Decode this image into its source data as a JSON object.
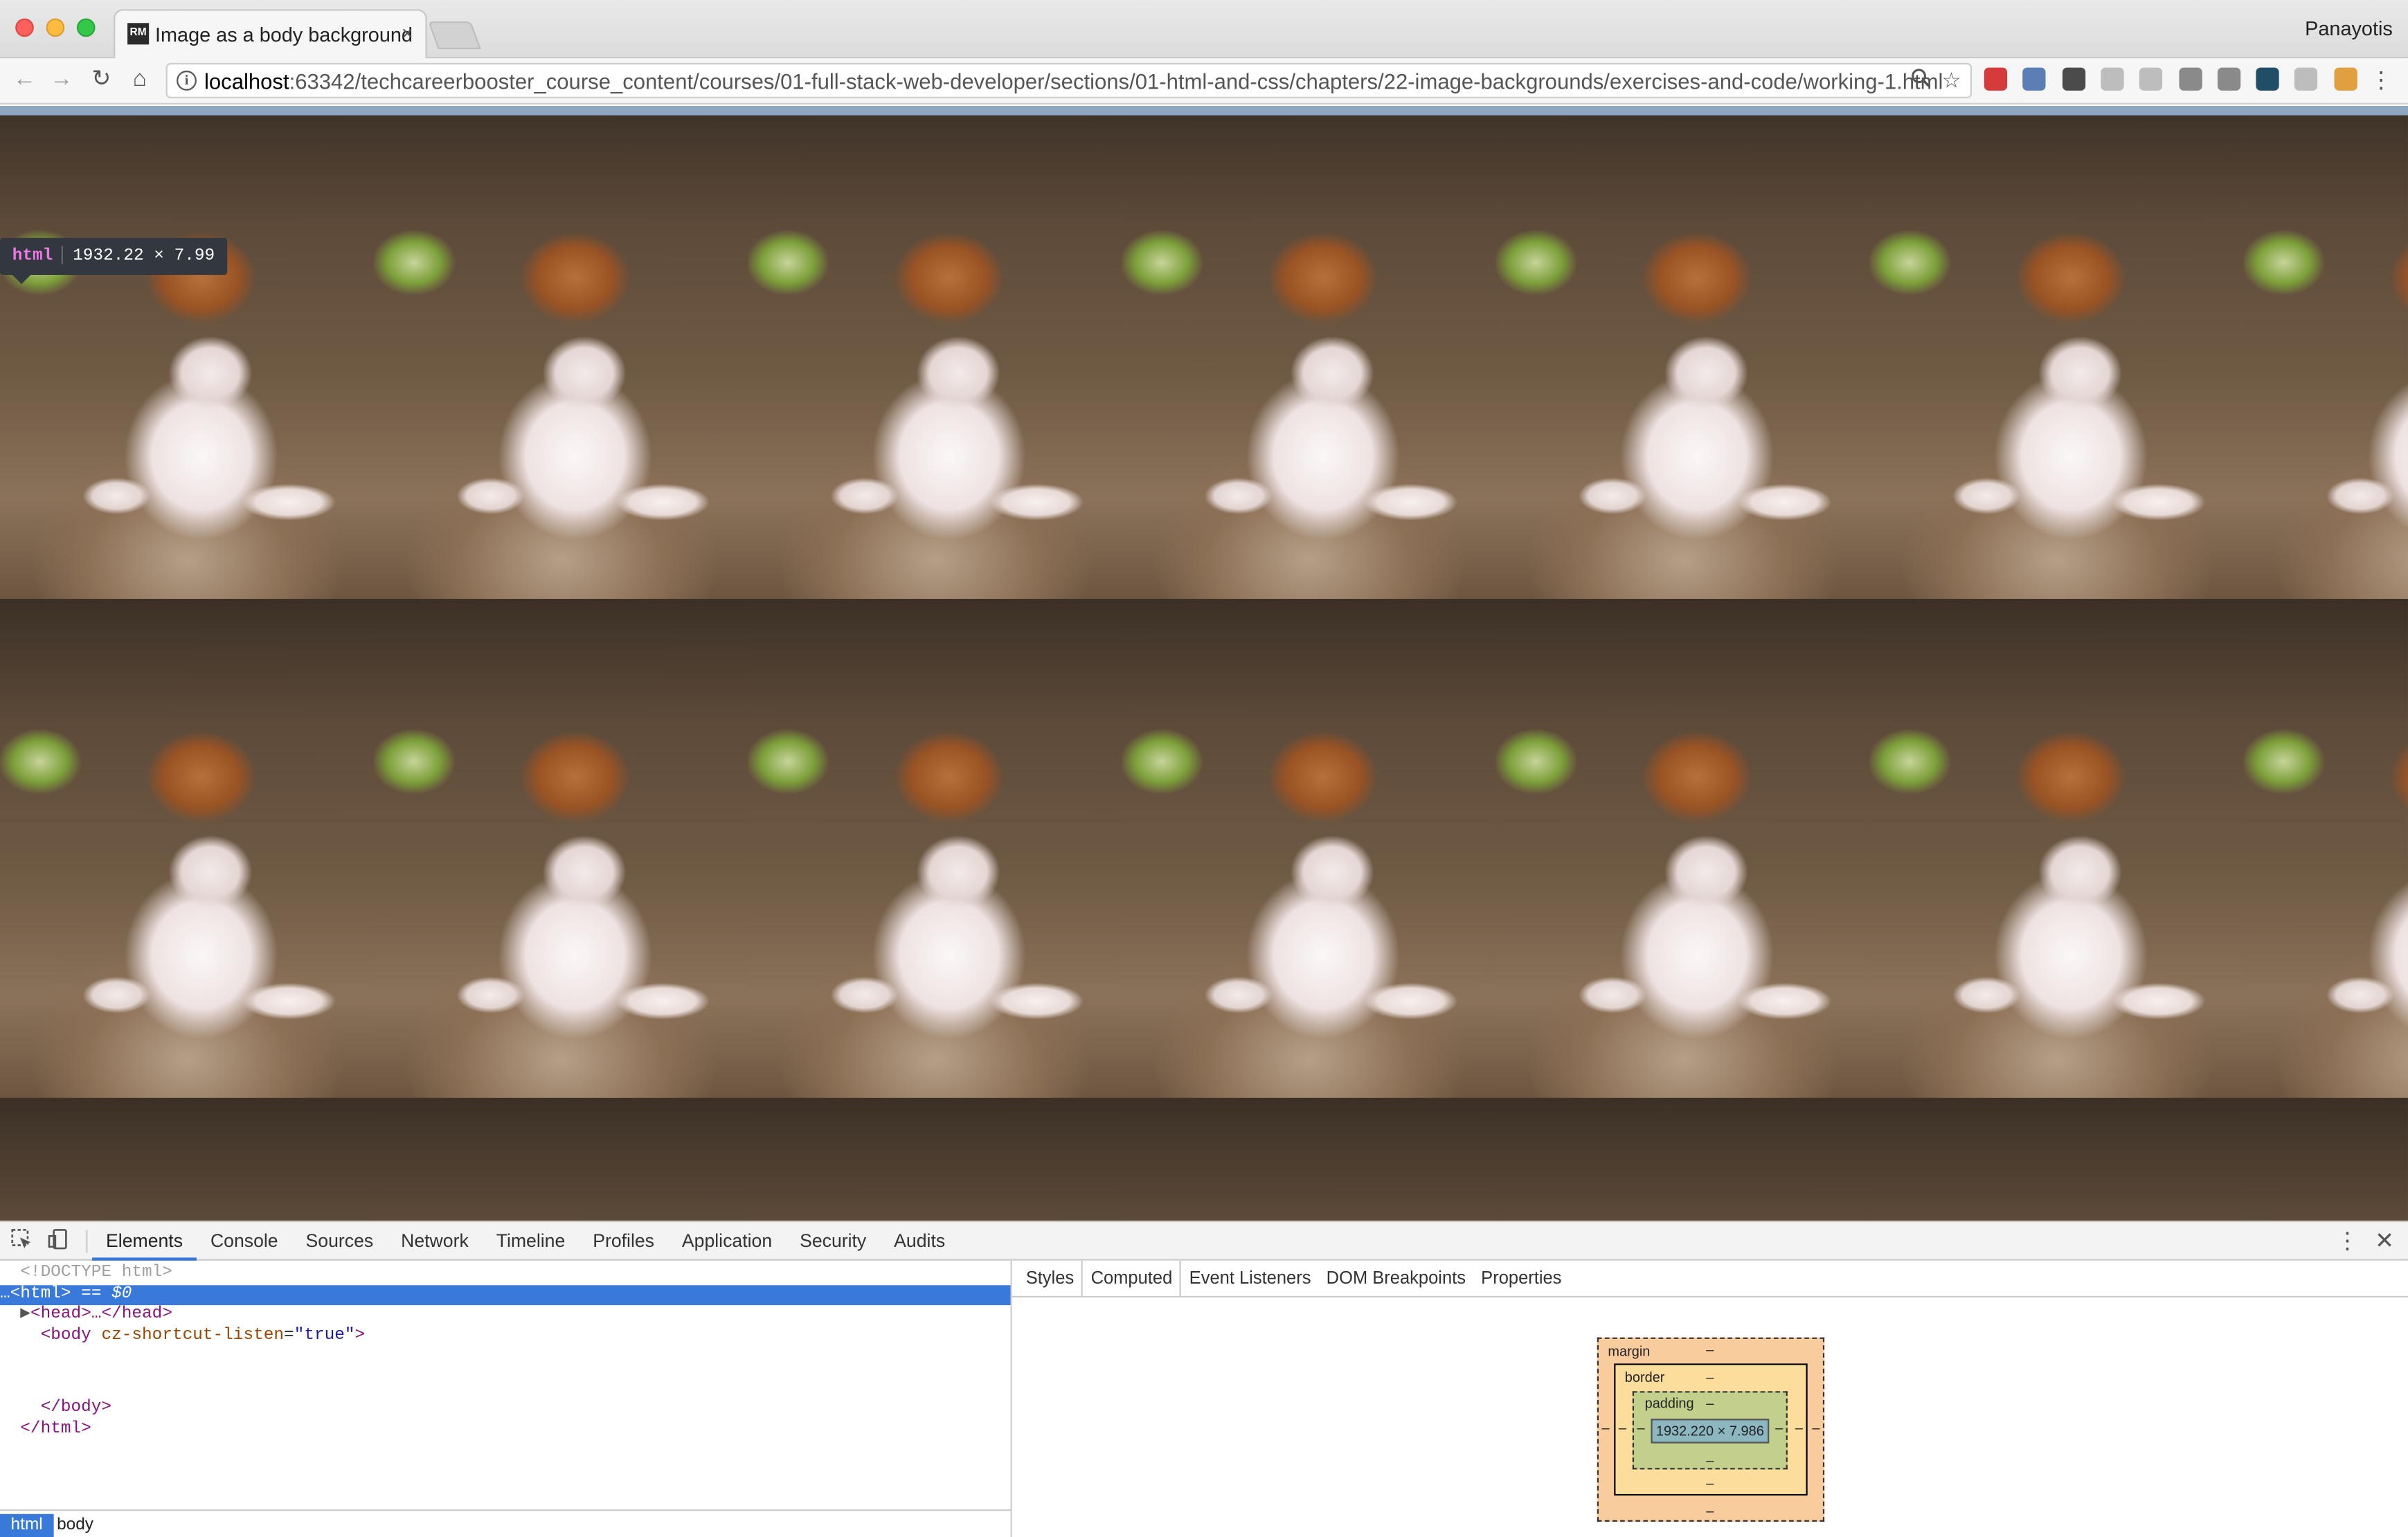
{
  "browser": {
    "tab_title": "Image as a body background",
    "tab_favicon": "RM",
    "user_name": "Panayotis",
    "url_host": "localhost",
    "url_rest": ":63342/techcareerbooster_course_content/courses/01-full-stack-web-developer/sections/01-html-and-css/chapters/22-image-backgrounds/exercises-and-code/working-1.html",
    "tab_close": "×",
    "nav": {
      "back": "←",
      "forward": "→",
      "reload": "↻",
      "home": "⌂"
    },
    "extension_colors": [
      "#d63b3b",
      "#5b7fb5",
      "#4b4b4b",
      "#bdbdbd",
      "#bdbdbd",
      "#8a8a8a",
      "#8a8a8a",
      "#1f4e66",
      "#bdbdbd",
      "#e0a040"
    ]
  },
  "viewport": {
    "tooltip_tag": "html",
    "tooltip_size": "1932.22 × 7.99",
    "background_tile_subject": "puppy"
  },
  "devtools": {
    "tabs": [
      "Elements",
      "Console",
      "Sources",
      "Network",
      "Timeline",
      "Profiles",
      "Application",
      "Security",
      "Audits"
    ],
    "active_tab": "Elements",
    "dom": {
      "doctype": "<!DOCTYPE html>",
      "html_open": "<html>",
      "selected_marker": "== $0",
      "head": "<head>…</head>",
      "body_open_tag": "<body",
      "body_attr_name": "cz-shortcut-listen",
      "body_attr_value": "\"true\"",
      "body_close": "</body>",
      "html_close": "</html>"
    },
    "breadcrumbs": [
      "html",
      "body"
    ],
    "sidebar_tabs": [
      "Styles",
      "Computed",
      "Event Listeners",
      "DOM Breakpoints",
      "Properties"
    ],
    "active_sidebar_tab": "Computed",
    "box_model": {
      "margin_label": "margin",
      "border_label": "border",
      "padding_label": "padding",
      "content_size": "1932.220 × 7.986",
      "empty_value": "–"
    }
  }
}
